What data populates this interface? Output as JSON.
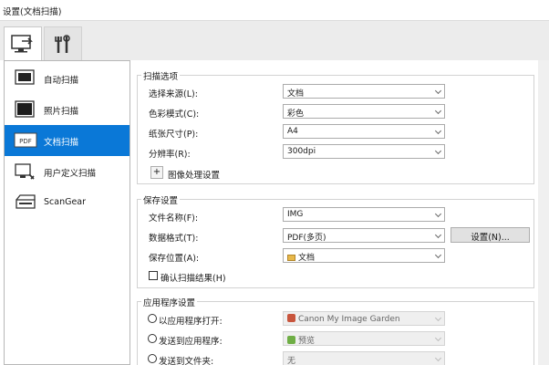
{
  "window": {
    "title": "设置(文档扫描)"
  },
  "tabs": [
    {
      "icon": "scan-from-computer-icon"
    },
    {
      "icon": "general-settings-tools-icon"
    }
  ],
  "sidebar": {
    "items": [
      {
        "label": "自动扫描",
        "icon": "auto-scan-icon"
      },
      {
        "label": "照片扫描",
        "icon": "photo-scan-icon"
      },
      {
        "label": "文档扫描",
        "icon": "document-scan-icon",
        "icon_text": "PDF",
        "selected": true
      },
      {
        "label": "用户定义扫描",
        "icon": "custom-scan-icon"
      },
      {
        "label": "ScanGear",
        "icon": "scangear-icon"
      }
    ]
  },
  "scan_options": {
    "title": "扫描选项",
    "source_label": "选择来源(L):",
    "source_value": "文档",
    "color_label": "色彩模式(C):",
    "color_value": "彩色",
    "paper_label": "纸张尺寸(P):",
    "paper_value": "A4",
    "resolution_label": "分辨率(R):",
    "resolution_value": "300dpi",
    "image_processing_label": "图像处理设置",
    "image_processing_button": "+"
  },
  "save_settings": {
    "title": "保存设置",
    "filename_label": "文件名称(F):",
    "filename_value": "IMG",
    "format_label": "数据格式(T):",
    "format_value": "PDF(多页)",
    "settings_button": "设置(N)...",
    "location_label": "保存位置(A):",
    "location_value": "文档",
    "confirm_label": "确认扫描结果(H)"
  },
  "app_settings": {
    "title": "应用程序设置",
    "open_with_label": "以应用程序打开:",
    "open_with_value": "Canon My Image Garden",
    "send_to_app_label": "发送到应用程序:",
    "send_to_app_value": "预览",
    "send_to_folder_label": "发送到文件夹:",
    "send_to_folder_value": "无"
  },
  "colors": {
    "selection": "#0a78d7"
  }
}
